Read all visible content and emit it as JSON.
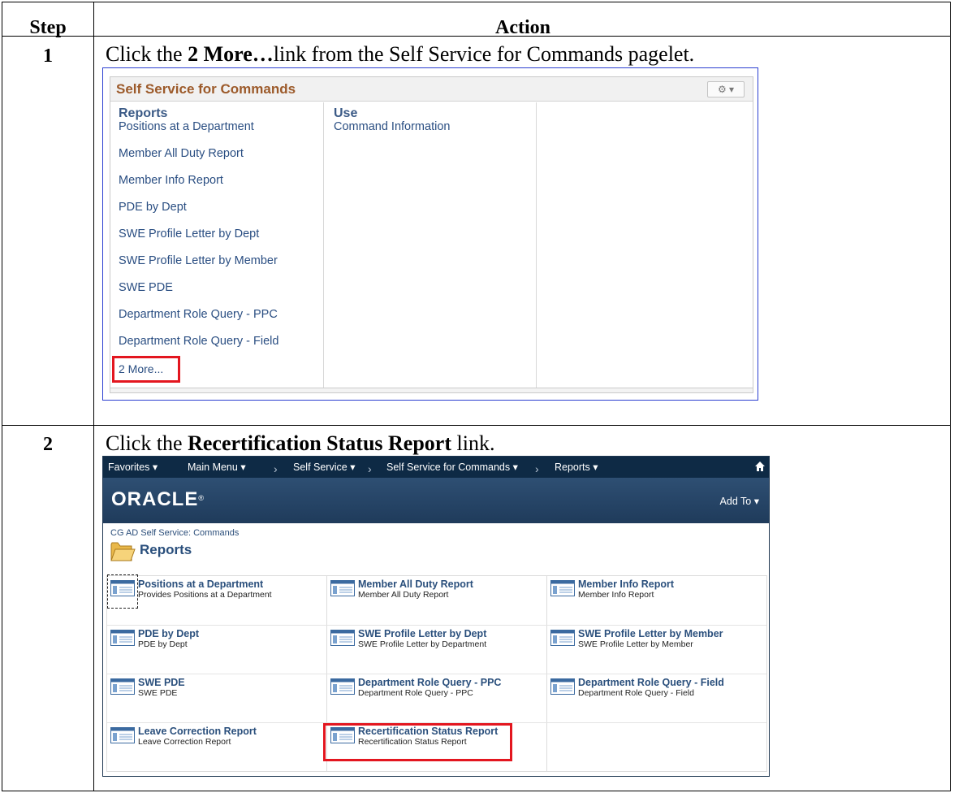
{
  "table": {
    "header_step": "Step",
    "header_action": "Action"
  },
  "steps": [
    {
      "number": "1",
      "text_before": "Click the ",
      "text_bold": "2 More…",
      "text_after": "link from the Self Service for Commands pagelet."
    },
    {
      "number": "2",
      "text_before": "Click the ",
      "text_bold": "Recertification Status Report",
      "text_after": " link."
    }
  ],
  "pagelet": {
    "title": "Self Service for Commands",
    "gear_icon": "gear-dropdown-icon",
    "columns": [
      {
        "heading": "Reports",
        "links": [
          "Positions at a Department",
          "Member All Duty Report",
          "Member Info Report",
          "PDE by Dept",
          "SWE Profile Letter by Dept",
          "SWE Profile Letter by Member",
          "SWE PDE",
          "Department Role Query - PPC",
          "Department Role Query - Field",
          "2 More..."
        ]
      },
      {
        "heading": "Use",
        "links": [
          "Command Information"
        ]
      }
    ],
    "highlight_color": "#e3161f"
  },
  "oracle": {
    "nav": {
      "favorites": "Favorites",
      "main_menu": "Main Menu",
      "crumb1": "Self Service",
      "crumb2": "Self Service for Commands",
      "crumb3": "Reports",
      "home_icon": "home-icon"
    },
    "logo": "ORACLE",
    "add_to": "Add To",
    "breadcrumb": "CG AD Self Service: Commands",
    "page_title": "Reports",
    "tiles": [
      {
        "name": "Positions at a Department",
        "desc": "Provides Positions at a Department"
      },
      {
        "name": "Member All Duty Report",
        "desc": "Member All Duty Report"
      },
      {
        "name": "Member Info Report",
        "desc": "Member Info Report"
      },
      {
        "name": "PDE by Dept",
        "desc": "PDE by Dept"
      },
      {
        "name": "SWE Profile Letter by Dept",
        "desc": "SWE Profile Letter by Department"
      },
      {
        "name": "SWE Profile Letter by Member",
        "desc": "SWE Profile Letter by Member"
      },
      {
        "name": "SWE PDE",
        "desc": "SWE PDE"
      },
      {
        "name": "Department Role Query - PPC",
        "desc": "Department Role Query - PPC"
      },
      {
        "name": "Department Role Query - Field",
        "desc": "Department Role Query - Field"
      },
      {
        "name": "Leave Correction Report",
        "desc": "Leave Correction Report"
      },
      {
        "name": "Recertification Status Report",
        "desc": "Recertification Status Report"
      }
    ],
    "colors": {
      "nav_bg": "#0e2a45",
      "brand_bg": "#1f3b5b",
      "link_blue": "#2a4f7c"
    }
  }
}
